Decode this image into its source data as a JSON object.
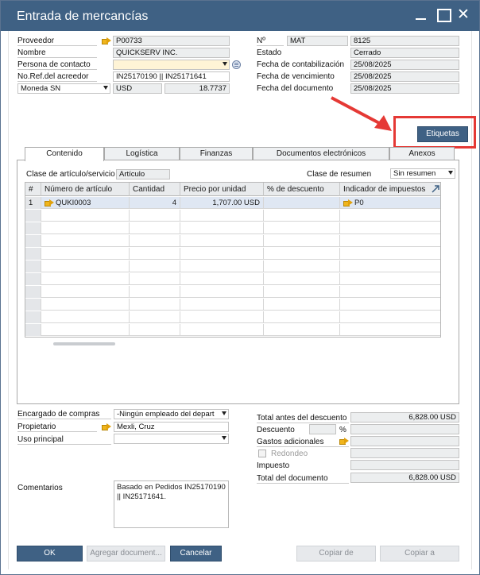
{
  "window": {
    "title": "Entrada de mercancías"
  },
  "header_left": {
    "proveedor": {
      "label": "Proveedor",
      "value": "P00733"
    },
    "nombre": {
      "label": "Nombre",
      "value": "QUICKSERV INC."
    },
    "persona_contacto": {
      "label": "Persona de contacto",
      "value": ""
    },
    "no_ref": {
      "label": "No.Ref.del acreedor",
      "value": "IN25170190  || IN25171641"
    },
    "moneda": {
      "label": "Moneda SN",
      "currency": "USD",
      "rate": "18.7737"
    }
  },
  "header_right": {
    "numero": {
      "label": "Nº",
      "series": "MAT",
      "value": "8125"
    },
    "estado": {
      "label": "Estado",
      "value": "Cerrado"
    },
    "fecha_contabilizacion": {
      "label": "Fecha de contabilización",
      "value": "25/08/2025"
    },
    "fecha_vencimiento": {
      "label": "Fecha de vencimiento",
      "value": "25/08/2025"
    },
    "fecha_documento": {
      "label": "Fecha del documento",
      "value": "25/08/2025"
    }
  },
  "etiquetas_button": "Etiquetas",
  "tabs": [
    "Contenido",
    "Logística",
    "Finanzas",
    "Documentos electrónicos",
    "Anexos"
  ],
  "contenido": {
    "clase_articulo": {
      "label": "Clase de artículo/servicio",
      "value": "Artículo"
    },
    "clase_resumen": {
      "label": "Clase de resumen",
      "value": "Sin resumen"
    },
    "columns": [
      "#",
      "Número de artículo",
      "Cantidad",
      "Precio por unidad",
      "% de descuento",
      "Indicador de impuestos"
    ],
    "rows": [
      {
        "num": "1",
        "articulo": "QUKI0003",
        "cantidad": "4",
        "precio": "1,707.00 USD",
        "descuento": "",
        "impuesto": "P0"
      }
    ]
  },
  "footer_left": {
    "encargado": {
      "label": "Encargado de compras",
      "value": "-Ningún empleado del depart"
    },
    "propietario": {
      "label": "Propietario",
      "value": "Mexli, Cruz"
    },
    "uso_principal": {
      "label": "Uso principal",
      "value": ""
    },
    "comentarios": {
      "label": "Comentarios",
      "value": "Basado en Pedidos IN25170190\n|| IN25171641."
    }
  },
  "totals": {
    "total_antes": {
      "label": "Total antes del descuento",
      "value": "6,828.00 USD"
    },
    "descuento": {
      "label": "Descuento",
      "percent_sign": "%",
      "value": ""
    },
    "gastos": {
      "label": "Gastos adicionales",
      "value": ""
    },
    "redondeo": {
      "label": "Redondeo",
      "value": ""
    },
    "impuesto": {
      "label": "Impuesto",
      "value": ""
    },
    "total_documento": {
      "label": "Total del documento",
      "value": "6,828.00 USD"
    }
  },
  "buttons": {
    "ok": "OK",
    "agregar": "Agregar document...",
    "cancelar": "Cancelar",
    "copiar_de": "Copiar de",
    "copiar_a": "Copiar a"
  },
  "colors": {
    "titlebar": "#3f6184",
    "primary_button": "#3f6184",
    "highlight": "#e53935",
    "link_arrow": "#f0b51c"
  }
}
